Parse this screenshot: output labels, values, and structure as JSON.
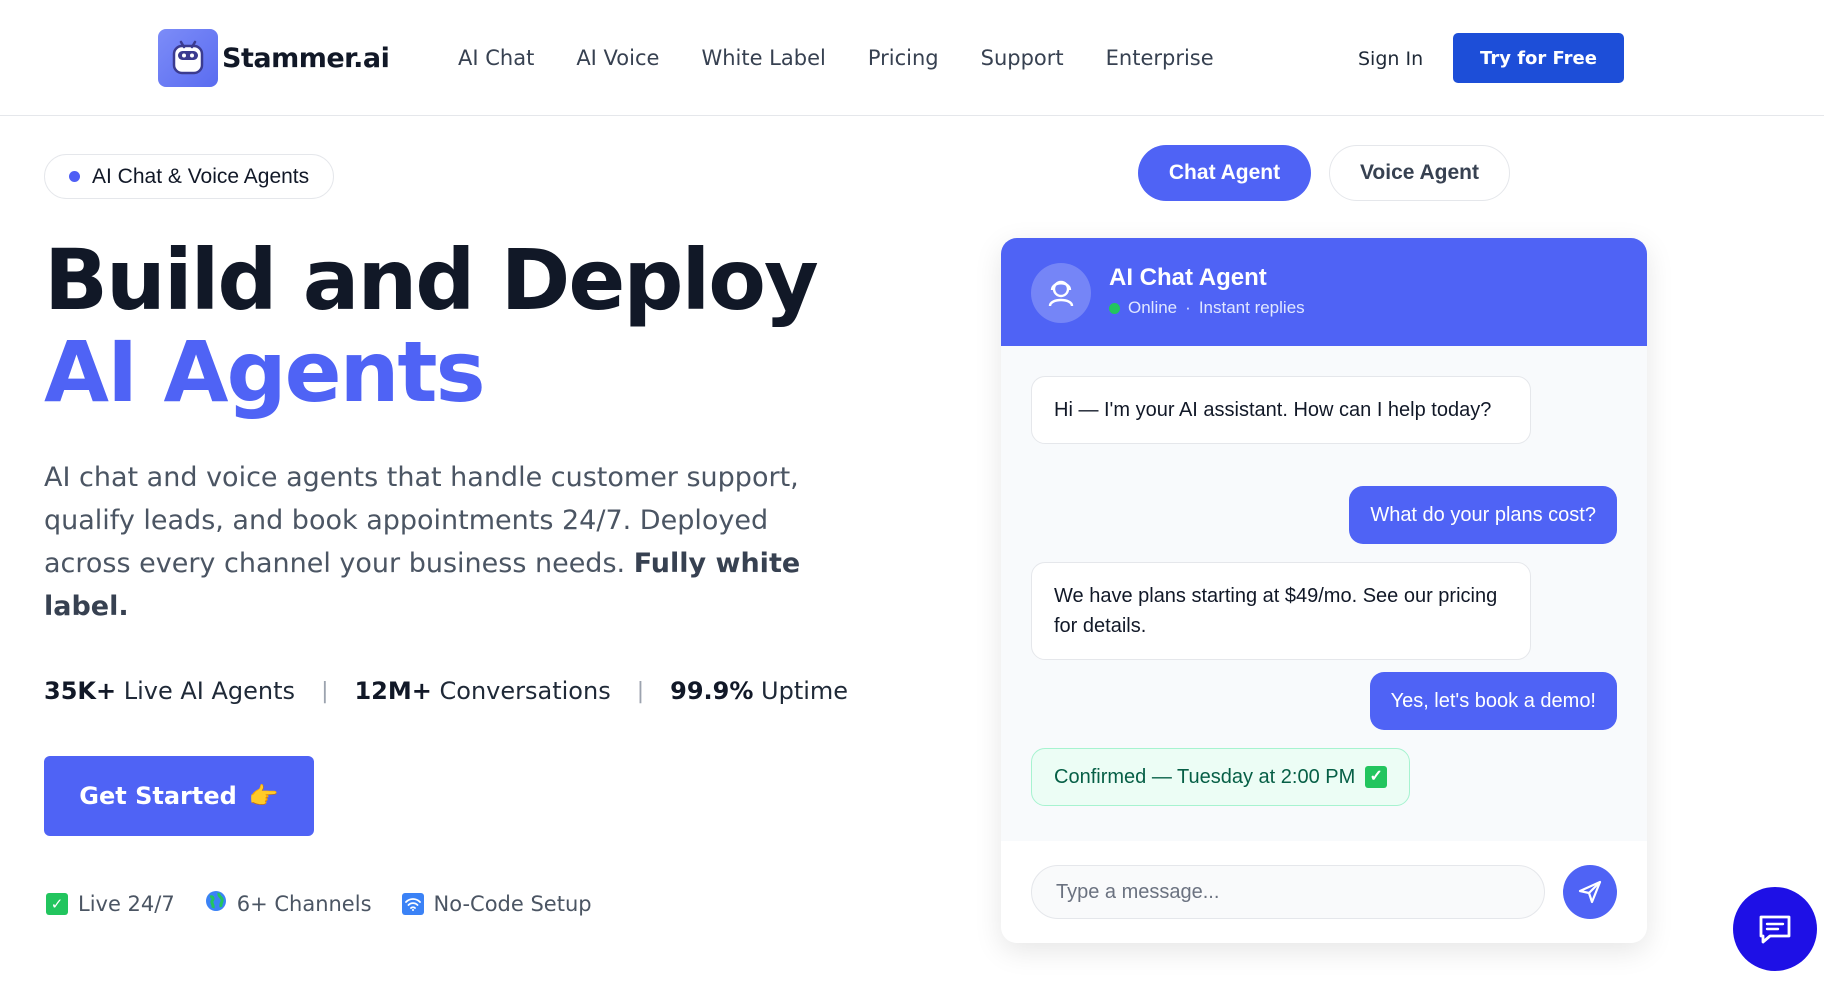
{
  "header": {
    "brand": "Stammer.ai",
    "nav": [
      "AI Chat",
      "AI Voice",
      "White Label",
      "Pricing",
      "Support",
      "Enterprise"
    ],
    "sign_in": "Sign In",
    "try_free": "Try for Free"
  },
  "hero": {
    "badge": "AI Chat & Voice Agents",
    "title_line1": "Build and Deploy",
    "title_line2": "AI Agents",
    "subtext": "AI chat and voice agents that handle customer support, qualify leads, and book appointments 24/7. Deployed across every channel your business needs.",
    "subtext_bold": "Fully white label.",
    "stats": [
      {
        "value": "35K+",
        "label": "Live AI Agents"
      },
      {
        "value": "12M+",
        "label": "Conversations"
      },
      {
        "value": "99.9%",
        "label": "Uptime"
      }
    ],
    "cta": "Get Started",
    "cta_emoji": "👉",
    "features": [
      {
        "icon": "check-icon",
        "label": "Live 24/7"
      },
      {
        "icon": "globe-icon",
        "label": "6+ Channels"
      },
      {
        "icon": "wifi-icon",
        "label": "No-Code Setup"
      }
    ]
  },
  "toggle": {
    "chat": "Chat Agent",
    "voice": "Voice Agent",
    "active": "Chat Agent"
  },
  "chat": {
    "agent_name": "AI Chat Agent",
    "status_online": "Online",
    "status_sep": "·",
    "status_detail": "Instant replies",
    "messages": [
      {
        "from": "bot",
        "text": "Hi — I'm your AI assistant. How can I help today?"
      },
      {
        "from": "user",
        "text": "What do your plans cost?"
      },
      {
        "from": "bot",
        "text": "We have plans starting at $49/mo. See our pricing for details."
      },
      {
        "from": "user",
        "text": "Yes, let's book a demo!"
      },
      {
        "from": "system",
        "text": "Confirmed — Tuesday at 2:00 PM"
      }
    ],
    "input_placeholder": "Type a message..."
  },
  "colors": {
    "accent": "#4f63f5",
    "brand_button": "#1d4ed8",
    "fab": "#1e10e6",
    "online": "#22c55e"
  }
}
